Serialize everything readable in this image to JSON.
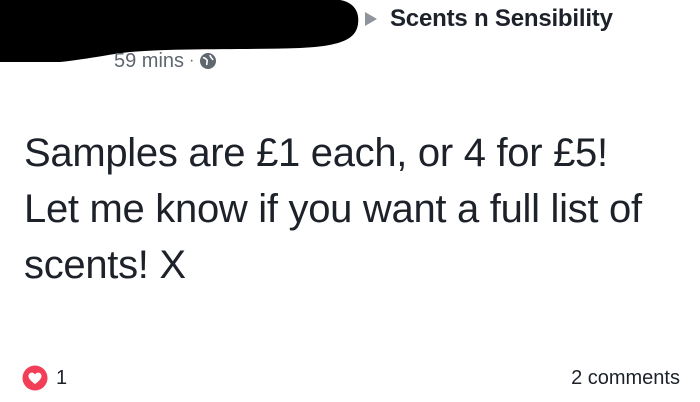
{
  "post": {
    "group_name": "Scents n Sensibility",
    "timestamp": "59 mins",
    "separator": "·",
    "body": "Samples are £1 each, or 4 for £5! Let me know if you want a full list of scents! X",
    "reaction_count": "1",
    "comments_label": "2 comments"
  },
  "icons": {
    "arrow": "right-triangle-icon",
    "audience": "globe-icon",
    "reaction": "heart-icon"
  },
  "colors": {
    "text": "#1d2129",
    "secondary_text": "#606770",
    "reaction": "#f33e58",
    "redaction": "#000000"
  }
}
